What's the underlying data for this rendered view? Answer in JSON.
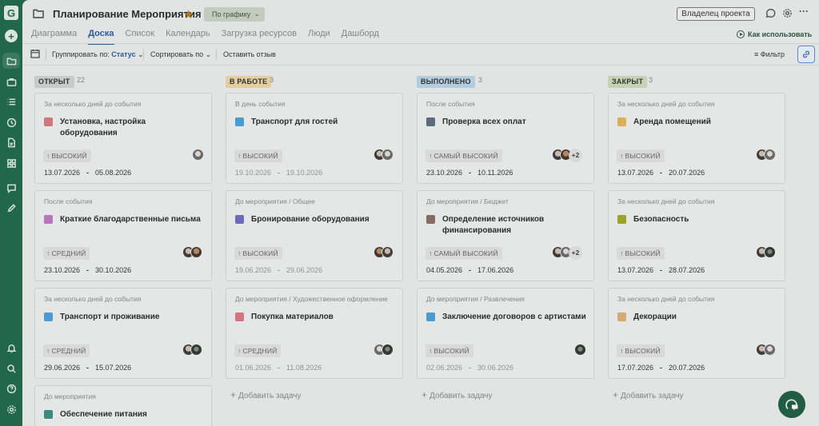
{
  "app": {
    "logo_letter": "G",
    "accent_color": "#1f6b50"
  },
  "rail": {
    "icons": [
      "logo-icon",
      "add-icon",
      "folder-icon",
      "briefcase-icon",
      "list-icon",
      "clock-icon",
      "document-icon",
      "grid-icon",
      "chat-icon",
      "pencil-icon",
      "bell-icon",
      "search-icon",
      "help-icon",
      "settings-icon"
    ]
  },
  "header": {
    "title": "Планирование Мероприятия",
    "schedule_label": "По графику",
    "owner_label": "Владелец проекта"
  },
  "tabs": [
    {
      "label": "Диаграмма",
      "active": false
    },
    {
      "label": "Доска",
      "active": true
    },
    {
      "label": "Список",
      "active": false
    },
    {
      "label": "Календарь",
      "active": false
    },
    {
      "label": "Загрузка ресурсов",
      "active": false
    },
    {
      "label": "Люди",
      "active": false
    },
    {
      "label": "Дашборд",
      "active": false
    }
  ],
  "how_to_use": "Как использовать",
  "toolbar": {
    "group_label": "Группировать по:",
    "group_value": "Статус",
    "sort_label": "Сортировать по",
    "feedback_label": "Оставить отзыв",
    "filter_label": "Фильтр"
  },
  "columns": [
    {
      "label": "ОТКРЫТ",
      "count": "22",
      "color": "#d5d7d7",
      "cards": [
        {
          "category": "За несколько дней до события",
          "color": "#e07a84",
          "title": "Установка, настройка оборудования",
          "priority_arrow": "↑",
          "priority": "ВЫСОКИЙ",
          "start": "13.07.2026",
          "end": "05.08.2026",
          "dim": false,
          "avatars": [
            "a3"
          ],
          "more": ""
        },
        {
          "category": "После события",
          "color": "#c07ac7",
          "title": "Краткие благодарственные письма",
          "priority_arrow": "↑",
          "priority": "СРЕДНИЙ",
          "start": "23.10.2026",
          "end": "30.10.2026",
          "dim": false,
          "avatars": [
            "a1",
            "a2"
          ],
          "more": ""
        },
        {
          "category": "За несколько дней до события",
          "color": "#4aa3df",
          "title": "Транспорт и проживание",
          "priority_arrow": "↑",
          "priority": "СРЕДНИЙ",
          "start": "29.06.2026",
          "end": "15.07.2026",
          "dim": false,
          "avatars": [
            "a1",
            "a4"
          ],
          "more": ""
        },
        {
          "category": "До мероприятия",
          "color": "#3d9185",
          "title": "Обеспечение питания",
          "priority_arrow": "",
          "priority": "",
          "start": "",
          "end": "",
          "dim": false,
          "avatars": [],
          "more": ""
        }
      ]
    },
    {
      "label": "В РАБОТЕ",
      "count": "3",
      "color": "#f2d9a6",
      "cards": [
        {
          "category": "В день события",
          "color": "#4aa3df",
          "title": "Транспорт для гостей",
          "priority_arrow": "↑",
          "priority": "ВЫСОКИЙ",
          "start": "19.10.2026",
          "end": "19.10.2026",
          "dim": true,
          "avatars": [
            "a1",
            "a3"
          ],
          "more": ""
        },
        {
          "category": "До мероприятия / Общее",
          "color": "#6f6fc0",
          "title": "Бронирование оборудования",
          "priority_arrow": "↑",
          "priority": "ВЫСОКИЙ",
          "start": "19.06.2026",
          "end": "29.06.2026",
          "dim": true,
          "avatars": [
            "a2",
            "a1"
          ],
          "more": ""
        },
        {
          "category": "До мероприятия / Художественное оформление",
          "color": "#e07a84",
          "title": "Покупка материалов",
          "priority_arrow": "↑",
          "priority": "СРЕДНИЙ",
          "start": "01.06.2026",
          "end": "11.08.2026",
          "dim": true,
          "avatars": [
            "a3",
            "a4"
          ],
          "more": ""
        }
      ],
      "add_label": "Добавить задачу"
    },
    {
      "label": "ВЫПОЛНЕНО",
      "count": "3",
      "color": "#bcd9ec",
      "cards": [
        {
          "category": "После события",
          "color": "#5f6f7f",
          "title": "Проверка всех оплат",
          "priority_arrow": "↑",
          "priority": "САМЫЙ ВЫСОКИЙ",
          "start": "23.10.2026",
          "end": "10.11.2026",
          "dim": false,
          "avatars": [
            "a1",
            "a2"
          ],
          "more": "+2"
        },
        {
          "category": "До мероприятия / Бюджет",
          "color": "#8a6f6a",
          "title": "Определение источников финансирования",
          "priority_arrow": "↑",
          "priority": "САМЫЙ ВЫСОКИЙ",
          "start": "04.05.2026",
          "end": "17.06.2026",
          "dim": false,
          "avatars": [
            "a1",
            "a3"
          ],
          "more": "+2"
        },
        {
          "category": "До мероприятия / Развлечения",
          "color": "#4aa3df",
          "title": "Заключение договоров с артистами",
          "priority_arrow": "↑",
          "priority": "ВЫСОКИЙ",
          "start": "02.06.2026",
          "end": "30.06.2026",
          "dim": true,
          "avatars": [
            "a4"
          ],
          "more": ""
        }
      ],
      "add_label": "Добавить задачу"
    },
    {
      "label": "ЗАКРЫТ",
      "count": "3",
      "color": "#cfe0bd",
      "cards": [
        {
          "category": "За несколько дней до события",
          "color": "#e8b95a",
          "title": "Аренда помещений",
          "priority_arrow": "↑",
          "priority": "ВЫСОКИЙ",
          "start": "13.07.2026",
          "end": "20.07.2026",
          "dim": false,
          "avatars": [
            "a1",
            "a3"
          ],
          "more": ""
        },
        {
          "category": "За несколько дней до события",
          "color": "#a2ad2a",
          "title": "Безопасность",
          "priority_arrow": "↑",
          "priority": "ВЫСОКИЙ",
          "start": "13.07.2026",
          "end": "28.07.2026",
          "dim": false,
          "avatars": [
            "a1",
            "a4"
          ],
          "more": ""
        },
        {
          "category": "За несколько дней до события",
          "color": "#e2b477",
          "title": "Декорации",
          "priority_arrow": "↑",
          "priority": "ВЫСОКИЙ",
          "start": "17.07.2026",
          "end": "20.07.2026",
          "dim": false,
          "avatars": [
            "a1",
            "a3"
          ],
          "more": ""
        }
      ],
      "add_label": "Добавить задачу"
    }
  ]
}
